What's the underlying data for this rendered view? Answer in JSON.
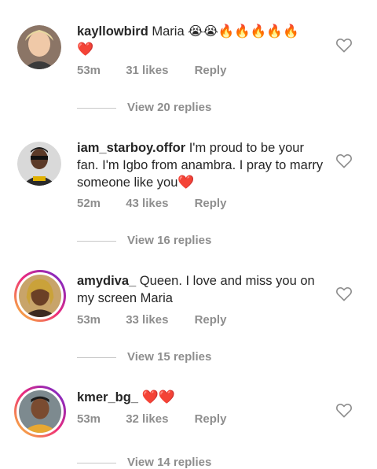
{
  "comments": [
    {
      "username": "kayllowbird",
      "text": " Maria 😭😭🔥🔥🔥🔥🔥",
      "text2": "❤️",
      "time": "53m",
      "likes": "31 likes",
      "reply": "Reply",
      "view_replies": "View 20 replies"
    },
    {
      "username": "iam_starboy.offor",
      "text": " I'm proud to be your fan. I'm Igbo from anambra. I pray to marry someone like you",
      "text_end": "❤️",
      "time": "52m",
      "likes": "43 likes",
      "reply": "Reply",
      "view_replies": "View 16 replies"
    },
    {
      "username": "amydiva_",
      "text": " Queen. I love and miss you on my screen Maria",
      "time": "53m",
      "likes": "33 likes",
      "reply": "Reply",
      "view_replies": "View 15 replies"
    },
    {
      "username": "kmer_bg_",
      "text": " ❤️❤️",
      "time": "53m",
      "likes": "32 likes",
      "reply": "Reply",
      "view_replies": "View 14 replies"
    }
  ],
  "icons": {
    "like": "heart-outline-icon"
  },
  "colors": {
    "meta": "#8e8e8e",
    "text": "#262626",
    "heart": "#e0245e"
  }
}
